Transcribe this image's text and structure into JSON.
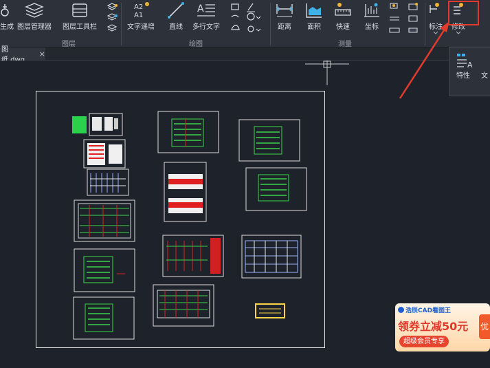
{
  "ribbon": {
    "buttons": {
      "generate": "生成",
      "layer_manager": "图层管理器",
      "layer_toolbar": "图层工具栏",
      "text_replace": "文字递增",
      "line": "直线",
      "mtext": "多行文字",
      "distance": "距离",
      "area": "面积",
      "quick": "快速",
      "coordinate": "坐标",
      "annotate": "标注",
      "modify": "修改"
    },
    "groups": {
      "layer": "图层",
      "draw": "绘图",
      "measure": "测量"
    }
  },
  "tabs": [
    {
      "label": "图纸.dwg",
      "close": "×"
    }
  ],
  "panel": {
    "properties": "特性",
    "text": "文"
  },
  "ad": {
    "brand": "浩辰CAD看图王",
    "headline": "领券立减50元",
    "sub": "超级会员专享",
    "side": "优"
  },
  "colors": {
    "accent_red": "#e23b2e",
    "canvas_bg": "#1e232b",
    "ribbon_bg": "#2c313a"
  }
}
